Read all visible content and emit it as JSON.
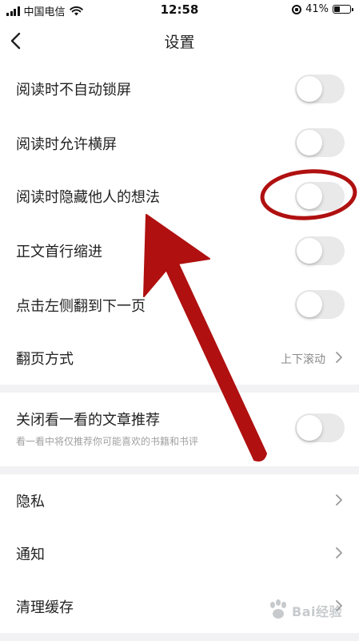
{
  "status_bar": {
    "carrier": "中国电信",
    "time": "12:58",
    "battery_text": "41%",
    "battery_level": 0.41
  },
  "nav": {
    "title": "设置"
  },
  "settings": {
    "keep_screen_on": {
      "label": "阅读时不自动锁屏",
      "enabled": false
    },
    "allow_landscape": {
      "label": "阅读时允许横屏",
      "enabled": false
    },
    "hide_others_thoughts": {
      "label": "阅读时隐藏他人的想法",
      "enabled": false
    },
    "first_line_indent": {
      "label": "正文首行缩进",
      "enabled": false
    },
    "tap_left_next_page": {
      "label": "点击左侧翻到下一页",
      "enabled": false
    },
    "page_turn_mode": {
      "label": "翻页方式",
      "value": "上下滚动"
    },
    "close_recommend": {
      "label": "关闭看一看的文章推荐",
      "subtext": "看一看中将仅推荐你可能喜欢的书籍和书评",
      "enabled": false
    },
    "privacy": {
      "label": "隐私"
    },
    "notifications": {
      "label": "通知"
    },
    "clear_cache": {
      "label": "清理缓存"
    }
  },
  "annotation": {
    "color": "#b01010"
  },
  "watermark": {
    "text": "Bai经验"
  },
  "colors": {
    "toggle_off": "#e9e9ea",
    "separator": "#f2f2f4",
    "secondary_text": "#8a8a8a"
  }
}
